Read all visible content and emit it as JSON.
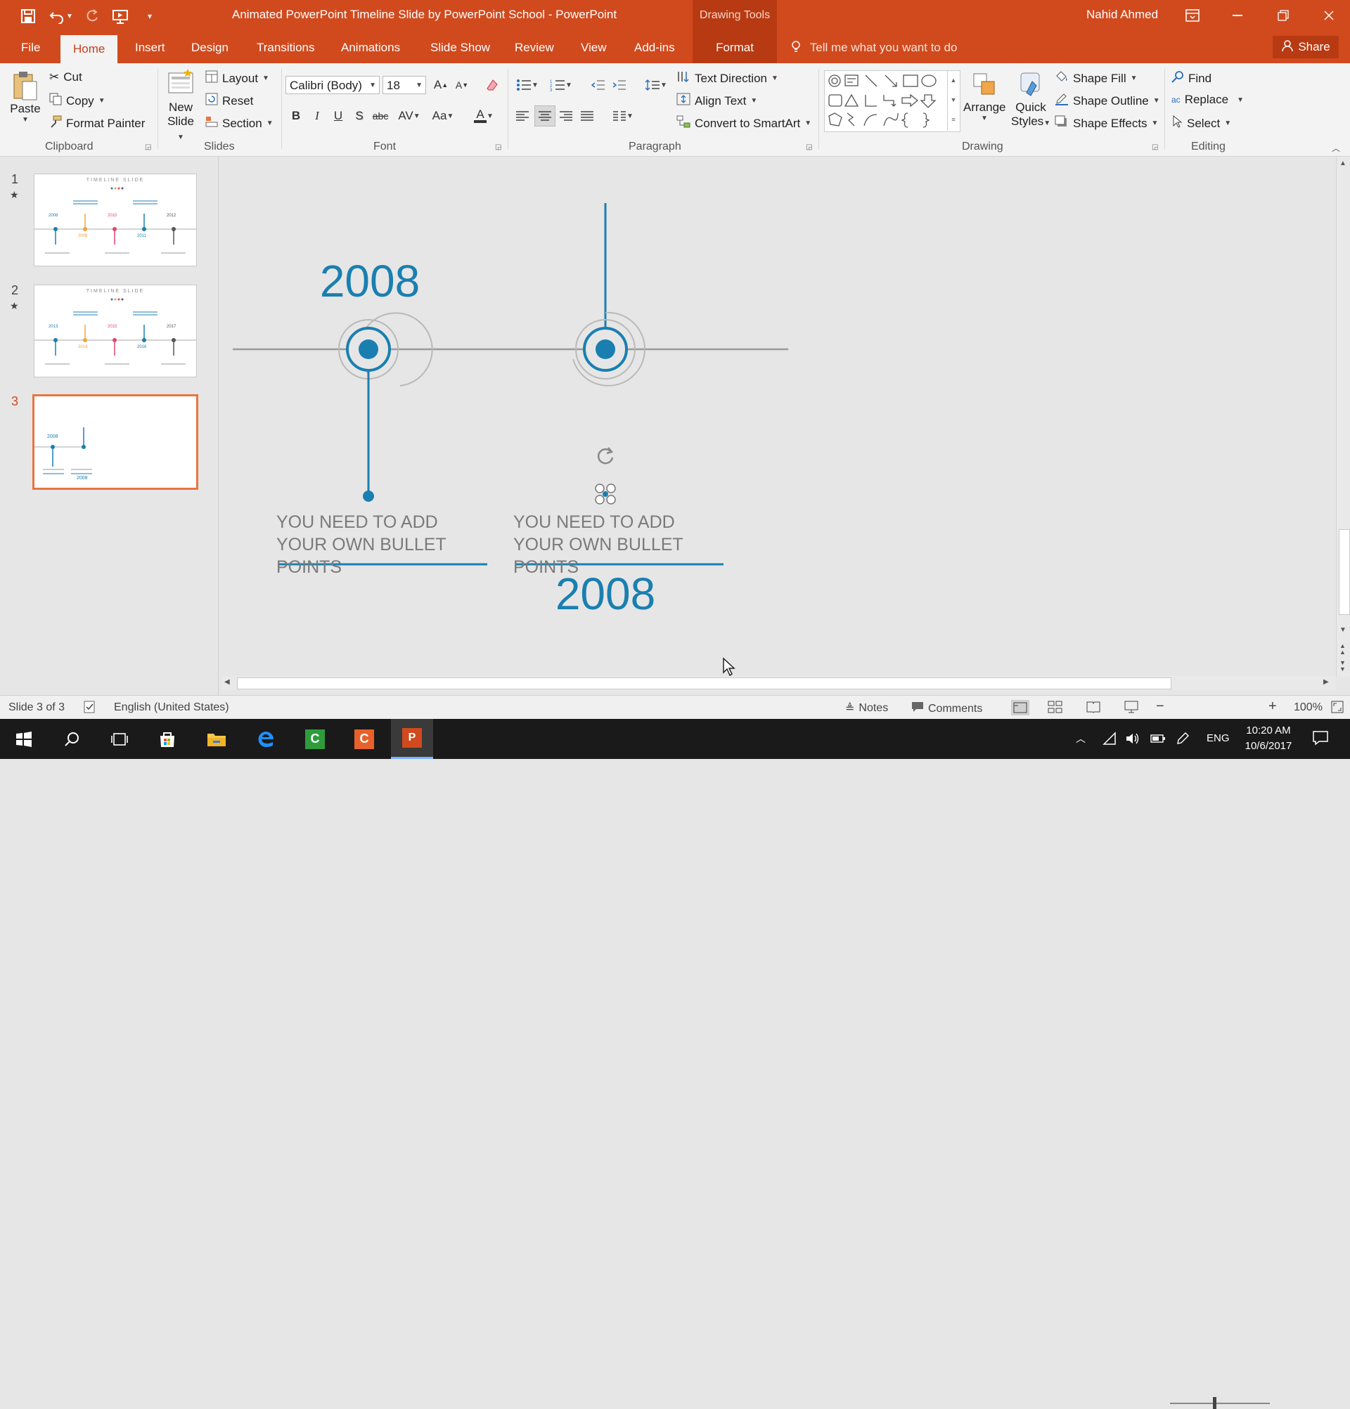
{
  "titlebar": {
    "document_title": "Animated PowerPoint Timeline Slide by PowerPoint School  -  PowerPoint",
    "context_tab_group": "Drawing Tools",
    "user_name": "Nahid Ahmed"
  },
  "tabs": {
    "file": "File",
    "home": "Home",
    "insert": "Insert",
    "design": "Design",
    "transitions": "Transitions",
    "animations": "Animations",
    "slide_show": "Slide Show",
    "review": "Review",
    "view": "View",
    "add_ins": "Add-ins",
    "format": "Format",
    "tell_me": "Tell me what you want to do",
    "share": "Share"
  },
  "ribbon": {
    "clipboard": {
      "group_label": "Clipboard",
      "paste": "Paste",
      "cut": "Cut",
      "copy": "Copy",
      "format_painter": "Format Painter"
    },
    "slides": {
      "group_label": "Slides",
      "new_slide_line1": "New",
      "new_slide_line2": "Slide",
      "layout": "Layout",
      "reset": "Reset",
      "section": "Section"
    },
    "font": {
      "group_label": "Font",
      "font_name": "Calibri (Body)",
      "font_size": "18",
      "bold": "B",
      "italic": "I",
      "underline": "U",
      "shadow": "S",
      "strike": "abc",
      "change_case": "Aa",
      "font_color_letter": "A"
    },
    "paragraph": {
      "group_label": "Paragraph",
      "text_direction": "Text Direction",
      "align_text": "Align Text",
      "convert_smartart": "Convert to SmartArt"
    },
    "drawing": {
      "group_label": "Drawing",
      "arrange": "Arrange",
      "quick_styles_line1": "Quick",
      "quick_styles_line2": "Styles",
      "shape_fill": "Shape Fill",
      "shape_outline": "Shape Outline",
      "shape_effects": "Shape Effects"
    },
    "editing": {
      "group_label": "Editing",
      "find": "Find",
      "replace": "Replace",
      "select": "Select"
    }
  },
  "slides_pane": {
    "slides": [
      {
        "number": "1",
        "mini_title": "TIMELINE SLIDE",
        "years": [
          "2008",
          "2009",
          "2010",
          "2011",
          "2012"
        ]
      },
      {
        "number": "2",
        "mini_title": "TIMELINE SLIDE",
        "years": [
          "2013",
          "2014",
          "2015",
          "2016",
          "2017"
        ]
      },
      {
        "number": "3",
        "years": [
          "2008",
          "2008"
        ]
      }
    ]
  },
  "slide": {
    "year_top": "2008",
    "year_bottom": "2008",
    "bullet_left_line1": "YOU NEED TO ADD",
    "bullet_left_line2": "YOUR OWN BULLET POINTS",
    "bullet_right_line1": "YOU NEED TO ADD",
    "bullet_right_line2": "YOUR OWN BULLET POINTS",
    "accent_color": "#1a7fb0",
    "line_color": "#9a9a9a"
  },
  "statusbar": {
    "slide_info": "Slide 3 of 3",
    "language": "English (United States)",
    "notes": "Notes",
    "comments": "Comments",
    "zoom": "100%"
  },
  "taskbar": {
    "language": "ENG",
    "time": "10:20 AM",
    "date": "10/6/2017"
  },
  "colors": {
    "brand_orange": "#d04a1e",
    "context_orange": "#b83a12",
    "selected_thumb": "#e8743f"
  }
}
